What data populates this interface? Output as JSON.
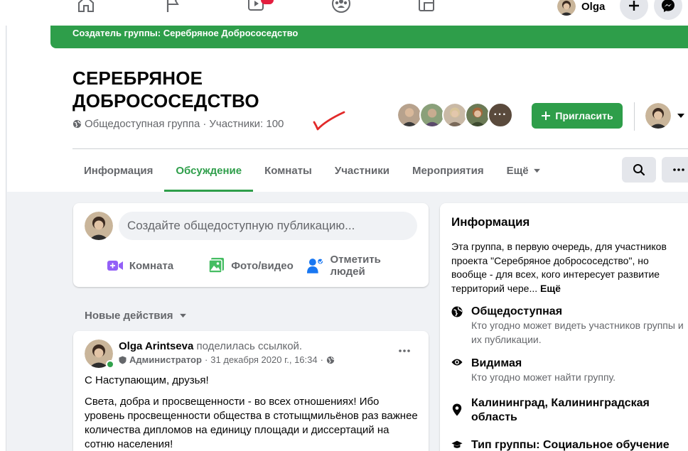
{
  "nav": {
    "user_name": "Olga"
  },
  "group": {
    "creator_banner": "Создатель группы: Серебряное Добрососедство",
    "title": "СЕРЕБРЯНОЕ ДОБРОСОСЕДСТВО",
    "privacy": "Общедоступная группа",
    "separator": "·",
    "members_label": "Участники: 100",
    "invite_label": "Пригласить"
  },
  "tabs": [
    {
      "label": "Информация"
    },
    {
      "label": "Обсуждение"
    },
    {
      "label": "Комнаты"
    },
    {
      "label": "Участники"
    },
    {
      "label": "Мероприятия"
    },
    {
      "label": "Ещё"
    }
  ],
  "composer": {
    "placeholder": "Создайте общедоступную публикацию...",
    "actions": [
      {
        "label": "Комната"
      },
      {
        "label": "Фото/видео"
      },
      {
        "label": "Отметить людей"
      }
    ]
  },
  "feed": {
    "sort_label": "Новые действия"
  },
  "post": {
    "author": "Olga Arintseva",
    "action": "поделилась ссылкой.",
    "role": "Администратор",
    "separator": "·",
    "date": "31 декабря 2020 г., 16:34",
    "more": "···",
    "paragraphs": [
      "С Наступающим, друзья!",
      "Света, добра и просвещенности - во всех отношениях! Ибо уровень просвещенности общества в стотыщмильёнов раз важнее количества дипломов на единицу площади и диссертаций на сотню населения!"
    ]
  },
  "info": {
    "title": "Информация",
    "description": "Эта группа, в первую очередь, для участников проекта \"Серебряное добрососедство\", но вообще - для всех, кого интересует развитие территорий чере...",
    "more_link": "Ещё",
    "items": [
      {
        "title": "Общедоступная",
        "subtitle": "Кто угодно может видеть участников группы и их публикации."
      },
      {
        "title": "Видимая",
        "subtitle": "Кто угодно может найти группу."
      },
      {
        "title": "Калининград, Калининградская область",
        "subtitle": ""
      },
      {
        "title": "Тип группы: Социальное обучение",
        "subtitle": ""
      }
    ]
  },
  "colors": {
    "brand_green": "#2e9e4a",
    "text_secondary": "#65676b",
    "badge_red": "#e41e3f"
  },
  "icons": [
    "home-icon",
    "flag-icon",
    "watch-icon",
    "groups-icon",
    "gaming-icon",
    "plus-icon",
    "messenger-icon",
    "globe-icon",
    "eye-icon",
    "location-pin-icon",
    "graduation-cap-icon",
    "search-icon",
    "more-dots-icon",
    "caret-down-icon",
    "video-room-icon",
    "photo-icon",
    "tag-people-icon"
  ]
}
